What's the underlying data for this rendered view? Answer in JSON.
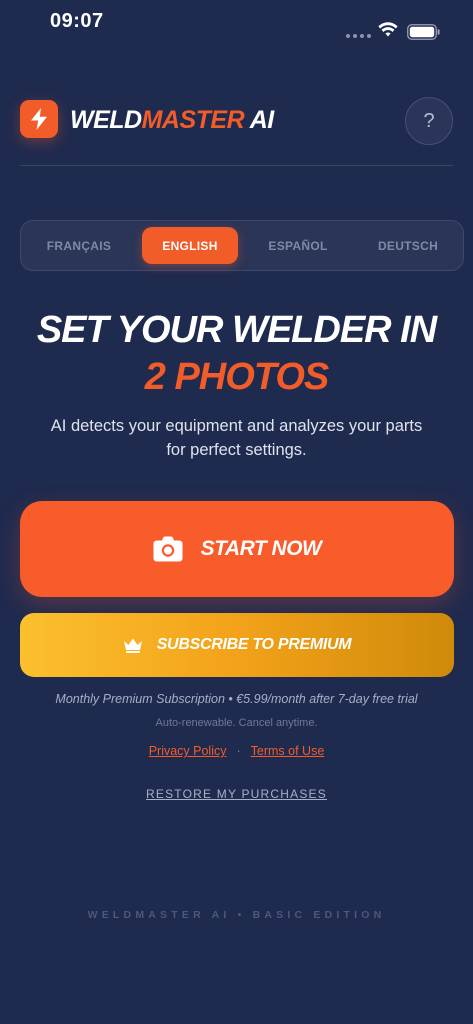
{
  "status_bar": {
    "time": "09:07"
  },
  "header": {
    "logo_part1": "WELD",
    "logo_part2": "MASTER",
    "logo_part3": " AI",
    "help_label": "?"
  },
  "languages": [
    {
      "label": "FRANÇAIS",
      "active": false
    },
    {
      "label": "ENGLISH",
      "active": true
    },
    {
      "label": "ESPAÑOL",
      "active": false
    },
    {
      "label": "DEUTSCH",
      "active": false
    }
  ],
  "hero": {
    "title_line1": "SET YOUR WELDER IN",
    "title_line2": "2 PHOTOS",
    "subtitle": "AI detects your equipment and analyzes your parts for perfect settings."
  },
  "actions": {
    "start_label": "START NOW",
    "premium_label": "SUBSCRIBE TO PREMIUM"
  },
  "legal": {
    "subscription_info": "Monthly Premium Subscription • €5.99/month after 7-day free trial",
    "auto_renew": "Auto-renewable. Cancel anytime.",
    "privacy_link": "Privacy Policy",
    "separator": "·",
    "terms_link": "Terms of Use",
    "restore_label": "RESTORE MY PURCHASES"
  },
  "footer": {
    "text": "WELDMASTER AI • BASIC EDITION"
  },
  "colors": {
    "background": "#1f2a4f",
    "accent": "#f25c28",
    "premium_start": "#fbc02d",
    "premium_end": "#cf8a0a"
  },
  "icons": {
    "logo": "lightning-bolt-icon",
    "start": "camera-icon",
    "premium": "crown-icon"
  }
}
